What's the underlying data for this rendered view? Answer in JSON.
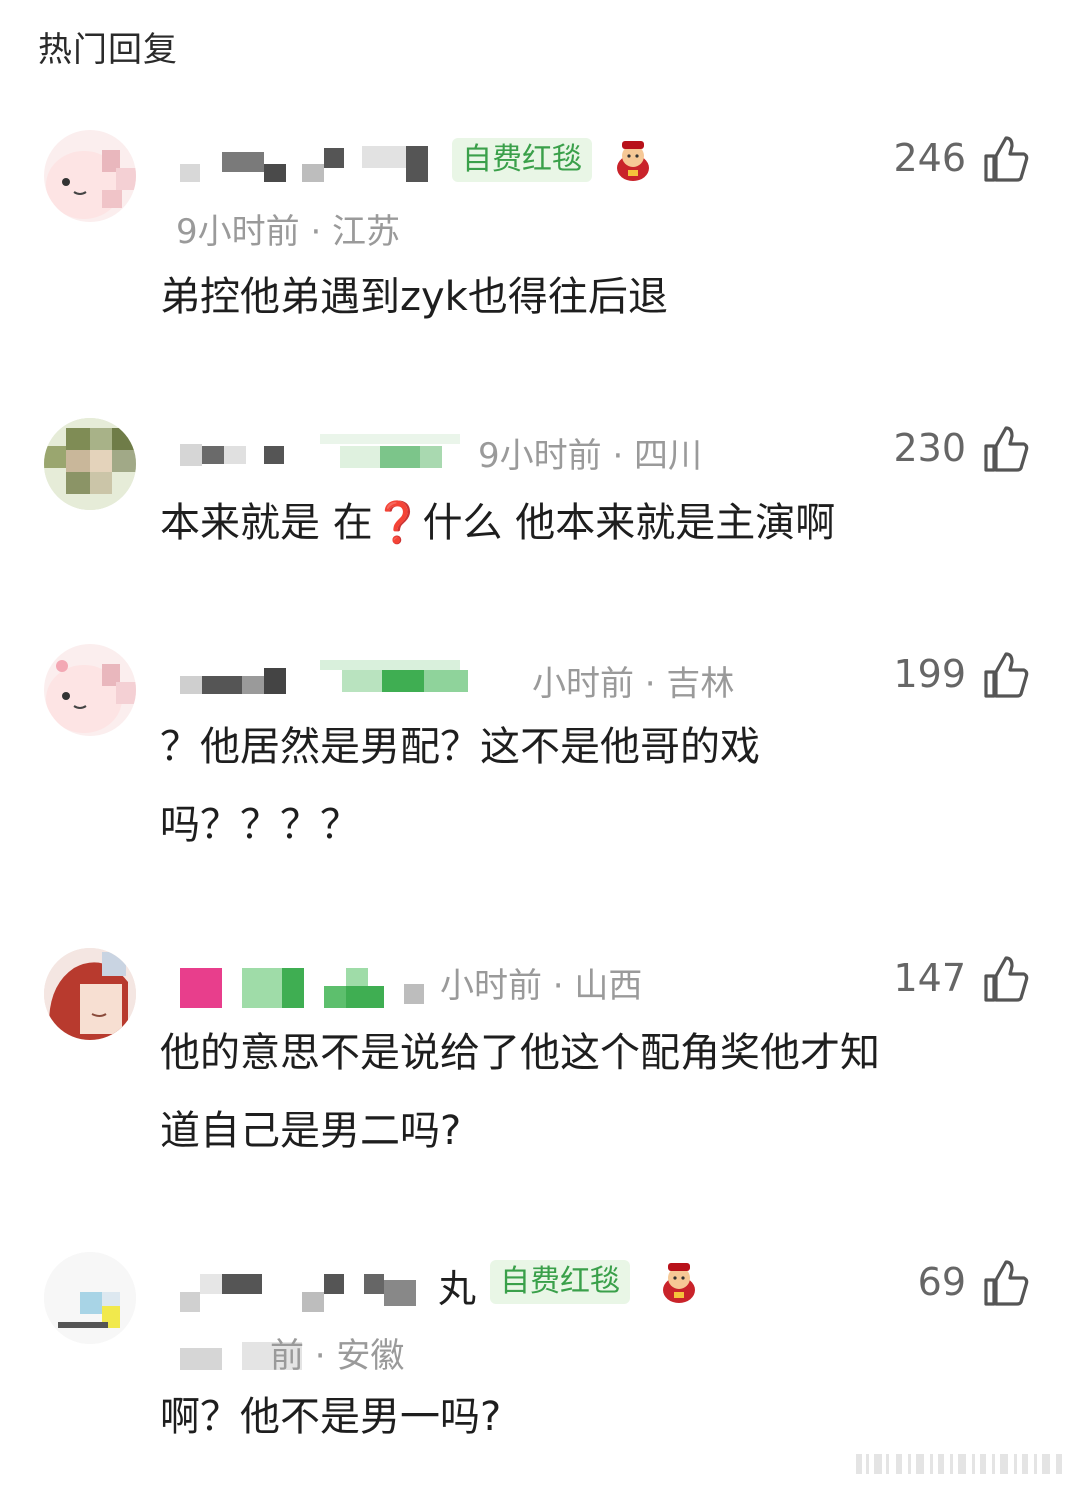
{
  "section_title": "热门回复",
  "comments": [
    {
      "badge": "自费红毯",
      "meta": "9小时前 · 江苏",
      "likes": "246",
      "content": "弟控他弟遇到zyk也得往后退"
    },
    {
      "meta": "9小时前 · 四川",
      "likes": "230",
      "content_parts": [
        "本来就是 在",
        "❓",
        "什么 他本来就是主演啊"
      ]
    },
    {
      "meta": "小时前 · 吉林",
      "likes": "199",
      "content_line1": "？他居然是男配？这不是他哥的戏",
      "content_line2": "吗？？？？"
    },
    {
      "meta": "小时前 · 山西",
      "likes": "147",
      "content_line1": "他的意思不是说给了他这个配角奖他才知",
      "content_line2": "道自己是男二吗?"
    },
    {
      "name_suffix": "丸",
      "badge": "自费红毯",
      "meta": "前 · 安徽",
      "likes": "69",
      "content": "啊？他不是男一吗?"
    }
  ],
  "colors": {
    "badge_bg": "#e9f6e6",
    "badge_text": "#3aa04a",
    "meta": "#9a9a9a",
    "like": "#666666",
    "question_red": "#e0343a"
  },
  "icons": [
    "thumbs-up-icon",
    "fortune-god-badge-icon"
  ]
}
